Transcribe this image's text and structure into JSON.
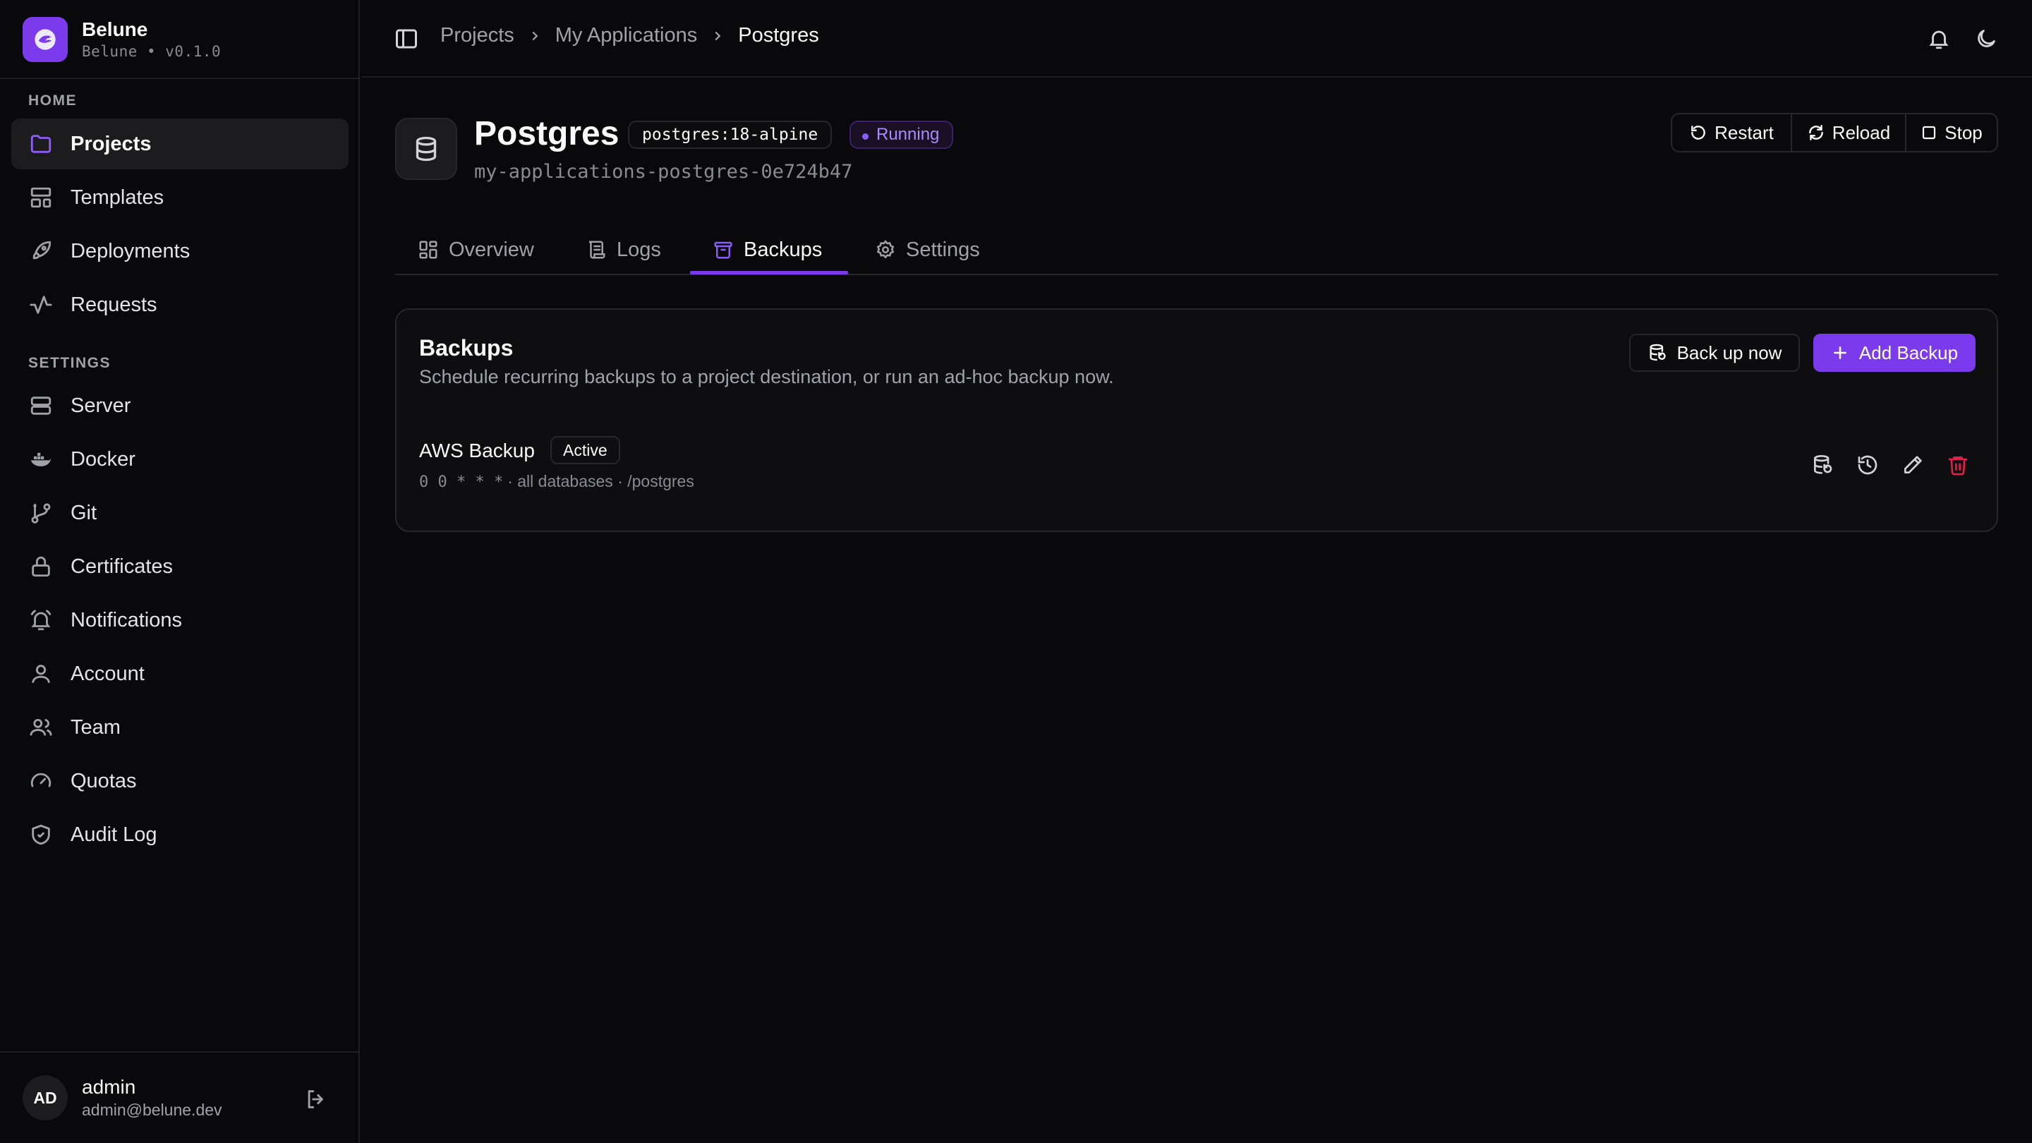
{
  "app": {
    "name": "Belune",
    "version_line": "Belune • v0.1.0"
  },
  "sidebar": {
    "home_label": "HOME",
    "settings_label": "SETTINGS",
    "home_items": [
      {
        "label": "Projects",
        "icon": "folder-icon",
        "active": true
      },
      {
        "label": "Templates",
        "icon": "layout-icon"
      },
      {
        "label": "Deployments",
        "icon": "rocket-icon"
      },
      {
        "label": "Requests",
        "icon": "activity-icon"
      }
    ],
    "settings_items": [
      {
        "label": "Server",
        "icon": "server-icon"
      },
      {
        "label": "Docker",
        "icon": "docker-icon"
      },
      {
        "label": "Git",
        "icon": "git-branch-icon"
      },
      {
        "label": "Certificates",
        "icon": "lock-icon"
      },
      {
        "label": "Notifications",
        "icon": "bell-ring-icon"
      },
      {
        "label": "Account",
        "icon": "user-icon"
      },
      {
        "label": "Team",
        "icon": "users-icon"
      },
      {
        "label": "Quotas",
        "icon": "gauge-icon"
      },
      {
        "label": "Audit Log",
        "icon": "shield-check-icon"
      }
    ],
    "user": {
      "initials": "AD",
      "name": "admin",
      "email": "admin@belune.dev"
    }
  },
  "topbar": {
    "breadcrumb": [
      "Projects",
      "My Applications",
      "Postgres"
    ]
  },
  "service": {
    "title": "Postgres",
    "image": "postgres:18-alpine",
    "status": "Running",
    "container_id": "my-applications-postgres-0e724b47",
    "actions": {
      "restart": "Restart",
      "reload": "Reload",
      "stop": "Stop"
    }
  },
  "tabs": [
    {
      "label": "Overview",
      "icon": "grid-icon"
    },
    {
      "label": "Logs",
      "icon": "scroll-icon"
    },
    {
      "label": "Backups",
      "icon": "archive-icon",
      "active": true
    },
    {
      "label": "Settings",
      "icon": "gear-icon"
    }
  ],
  "backups": {
    "title": "Backups",
    "description": "Schedule recurring backups to a project destination, or run an ad-hoc backup now.",
    "back_up_now": "Back up now",
    "add_backup": "Add Backup",
    "items": [
      {
        "name": "AWS Backup",
        "status": "Active",
        "cron": "0 0 * * *",
        "details": "· all databases · /postgres"
      }
    ]
  },
  "colors": {
    "accent": "#7c3aed",
    "background": "#09090b",
    "danger": "#e11d48"
  }
}
